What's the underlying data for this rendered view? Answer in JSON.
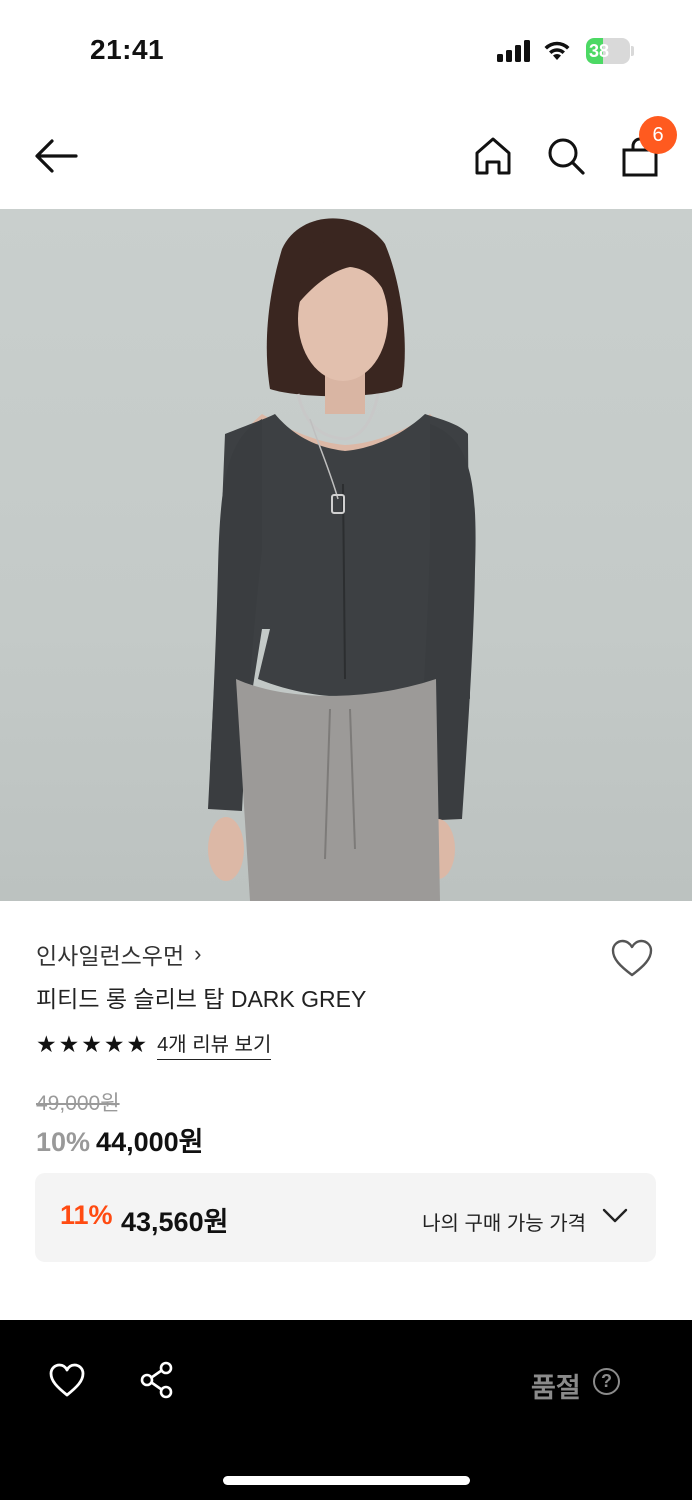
{
  "status_bar": {
    "time": "21:41",
    "battery_level": "38",
    "battery_fraction": 0.38
  },
  "nav": {
    "cart_count": "6"
  },
  "product": {
    "brand": "인사일런스우먼",
    "brand_chevron": "›",
    "name": "피티드 롱 슬리브 탑 DARK GREY",
    "rating_stars": 5,
    "review_link": "4개 리뷰 보기",
    "original_price": "49,000원",
    "discount_rate": "10%",
    "sale_price": "44,000원"
  },
  "my_price": {
    "discount_rate": "11%",
    "price": "43,560원",
    "label": "나의 구매 가능 가격"
  },
  "bottom_bar": {
    "status": "품절",
    "help": "?"
  },
  "colors": {
    "accent": "#ff4b12",
    "badge": "#ff5a1f",
    "battery": "#4cd964"
  },
  "icons": [
    "back-arrow-icon",
    "home-icon",
    "search-icon",
    "shopping-bag-icon",
    "heart-icon",
    "share-icon",
    "help-icon",
    "chevron-down-icon"
  ]
}
